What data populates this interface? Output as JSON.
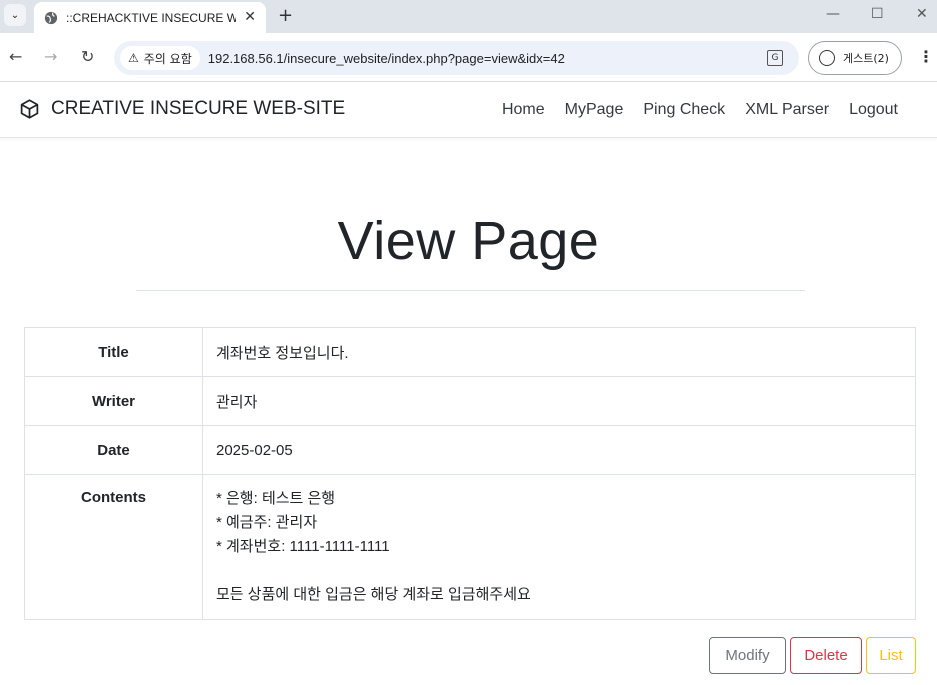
{
  "browser": {
    "tab_title": "::CREHACKTIVE INSECURE WEB",
    "security_chip": "주의 요함",
    "url": "192.168.56.1/insecure_website/index.php?page=view&idx=42",
    "profile_label": "게스트(2)"
  },
  "site": {
    "brand": "CREATIVE INSECURE WEB-SITE",
    "nav": [
      "Home",
      "MyPage",
      "Ping Check",
      "XML Parser",
      "Logout"
    ]
  },
  "page": {
    "heading": "View Page"
  },
  "post": {
    "title_label": "Title",
    "title": "계좌번호 정보입니다.",
    "writer_label": "Writer",
    "writer": "관리자",
    "date_label": "Date",
    "date": "2025-02-05",
    "contents_label": "Contents",
    "contents": "* 은행: 테스트 은행\n* 예금주: 관리자\n* 계좌번호: 1111-1111-1111\n\n모든 상품에 대한 입금은 해당 계좌로 입금해주세요"
  },
  "actions": {
    "modify": "Modify",
    "delete": "Delete",
    "list": "List"
  },
  "colors": {
    "modify": "#6c757d",
    "delete": "#dc3545",
    "list": "#ffc107"
  }
}
